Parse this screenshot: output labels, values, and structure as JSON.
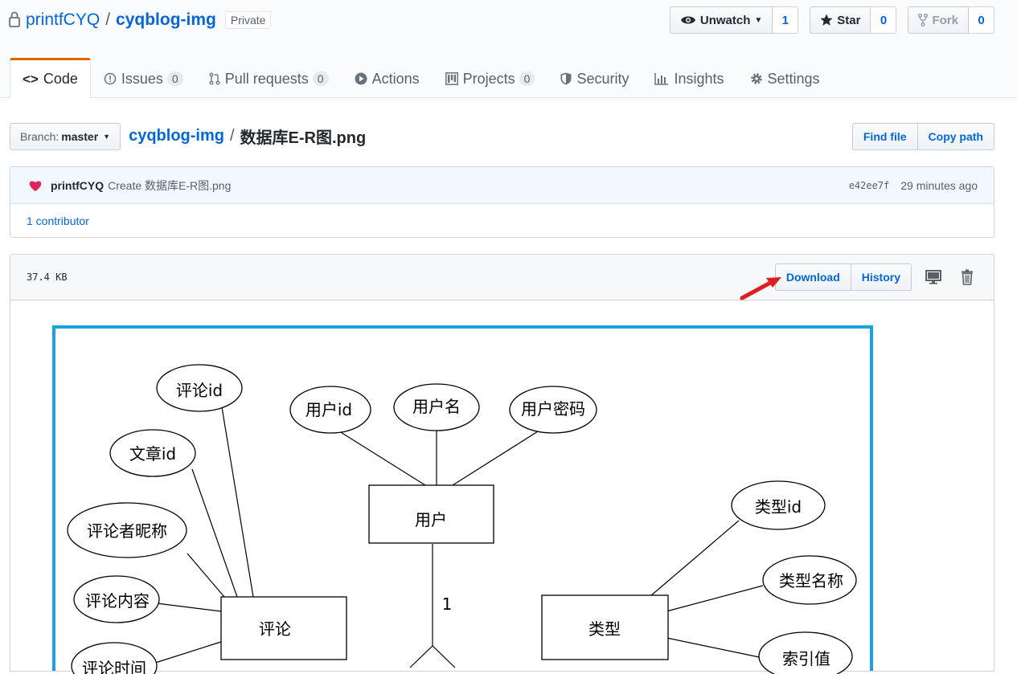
{
  "repo": {
    "owner": "printfCYQ",
    "separator": "/",
    "name": "cyqblog-img",
    "visibility": "Private"
  },
  "header_actions": {
    "watch": {
      "label": "Unwatch",
      "count": "1"
    },
    "star": {
      "label": "Star",
      "count": "0"
    },
    "fork": {
      "label": "Fork",
      "count": "0"
    }
  },
  "tabs": [
    {
      "label": "Code",
      "icon": "code-icon"
    },
    {
      "label": "Issues",
      "icon": "issue-icon",
      "count": "0"
    },
    {
      "label": "Pull requests",
      "icon": "pull-request-icon",
      "count": "0"
    },
    {
      "label": "Actions",
      "icon": "play-icon"
    },
    {
      "label": "Projects",
      "icon": "project-icon",
      "count": "0"
    },
    {
      "label": "Security",
      "icon": "shield-icon"
    },
    {
      "label": "Insights",
      "icon": "graph-icon"
    },
    {
      "label": "Settings",
      "icon": "gear-icon"
    }
  ],
  "file_nav": {
    "branch_label": "Branch:",
    "branch_value": "master",
    "breadcrumb_root": "cyqblog-img",
    "breadcrumb_sep": "/",
    "breadcrumb_file": "数据库E-R图.png",
    "find_file": "Find file",
    "copy_path": "Copy path"
  },
  "commit": {
    "author": "printfCYQ",
    "message": "Create 数据库E-R图.png",
    "sha": "e42ee7f",
    "time": "29 minutes ago",
    "contributors": "1 contributor"
  },
  "file": {
    "size": "37.4 KB",
    "download": "Download",
    "history": "History"
  },
  "diagram": {
    "entities": [
      "用户",
      "评论",
      "类型"
    ],
    "attributes": {
      "user": [
        "用户id",
        "用户名",
        "用户密码"
      ],
      "comment": [
        "评论id",
        "文章id",
        "评论者昵称",
        "评论内容",
        "评论时间"
      ],
      "type": [
        "类型id",
        "类型名称",
        "索引值"
      ]
    },
    "cardinality": "1"
  },
  "colors": {
    "accent_tab": "#e36209",
    "link": "#0366d6",
    "image_border": "#1ba1e2",
    "annotation_arrow": "#e02020"
  }
}
